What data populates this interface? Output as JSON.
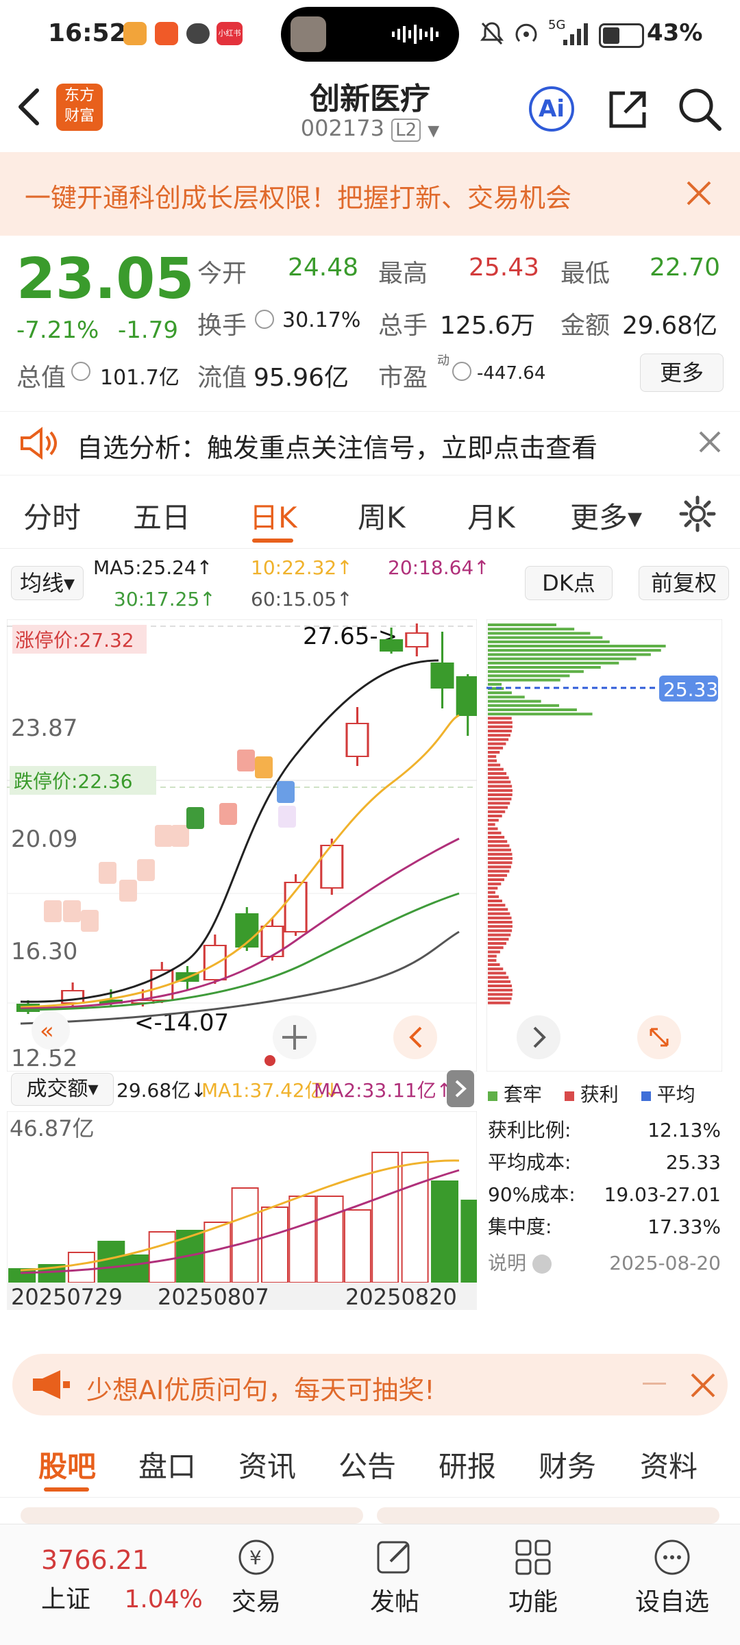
{
  "status": {
    "time": "16:52",
    "battery": "43%",
    "network": "5G",
    "icons": [
      "shield-icon",
      "app-badge-icon",
      "wechat-icon",
      "xiaohongshu-icon"
    ],
    "notification_badge": "小红书"
  },
  "nav": {
    "title": "创新医疗",
    "code": "002173",
    "level": "L2",
    "logo_top": "东方",
    "logo_bottom": "财富",
    "ai_label": "Ai"
  },
  "banner": {
    "text": "一键开通科创成长层权限！把握打新、交易机会"
  },
  "quote": {
    "price": "23.05",
    "change_pct": "-7.21%",
    "change": "-1.79",
    "open_label": "今开",
    "open": "24.48",
    "high_label": "最高",
    "high": "25.43",
    "low_label": "最低",
    "low": "22.70",
    "turnover_label": "换手",
    "turnover": "30.17%",
    "volume_label": "总手",
    "volume": "125.6万",
    "amount_label": "金额",
    "amount": "29.68亿",
    "mktcap_label": "总值",
    "mktcap": "101.7亿",
    "float_label": "流值",
    "float": "95.96亿",
    "pe_label": "市盈",
    "pe_sup": "动",
    "pe": "-447.64",
    "more_label": "更多"
  },
  "notice": {
    "text": "自选分析：触发重点关注信号，立即点击查看"
  },
  "tabs": {
    "items": [
      "分时",
      "五日",
      "日K",
      "周K",
      "月K",
      "更多▾"
    ],
    "active": 2
  },
  "kline": {
    "ma_selector": "均线▾",
    "ma5": "MA5:25.24↑",
    "ma10": "10:22.32↑",
    "ma20": "20:18.64↑",
    "ma30": "30:17.25↑",
    "ma60": "60:15.05↑",
    "dk_label": "DK点",
    "fq_label": "前复权",
    "limit_up": "涨停价:27.32",
    "limit_down": "跌停价:22.36",
    "price_ticks": [
      "23.87",
      "20.09",
      "16.30",
      "12.52"
    ],
    "max_label": "27.65->",
    "min_label": "<-14.07",
    "badge_price": "25.33",
    "vol_selector": "成交额▾",
    "vol_values": "29.68亿↓",
    "vol_ma1": "MA1:37.42亿↓",
    "vol_ma2": "MA2:33.11亿↑",
    "vol_max": "46.87亿",
    "dates": [
      "20250729",
      "20250807",
      "20250820"
    ]
  },
  "chips": {
    "legend": [
      "套牢",
      "获利",
      "平均"
    ],
    "rows": [
      {
        "label": "获利比例:",
        "value": "12.13%"
      },
      {
        "label": "平均成本:",
        "value": "25.33"
      },
      {
        "label": "90%成本:",
        "value": "19.03-27.01"
      },
      {
        "label": "集中度:",
        "value": "17.33%"
      }
    ],
    "note_label": "说明",
    "date": "2025-08-20"
  },
  "promo": {
    "text": "少想AI优质问句，每天可抽奖!"
  },
  "bottom_tabs": {
    "items": [
      "股吧",
      "盘口",
      "资讯",
      "公告",
      "研报",
      "财务",
      "资料"
    ],
    "active": 0
  },
  "botnav": {
    "index_value": "3766.21",
    "index_name": "上证",
    "index_pct": "1.04%",
    "items": [
      "交易",
      "发帖",
      "功能",
      "设自选"
    ]
  },
  "colors": {
    "up": "#d23b3b",
    "down": "#3a9b2c",
    "accent": "#e8601c",
    "ma10": "#f0b22c",
    "ma20": "#b0307a",
    "ma30": "#3f9b3a",
    "ma60": "#555555"
  }
}
